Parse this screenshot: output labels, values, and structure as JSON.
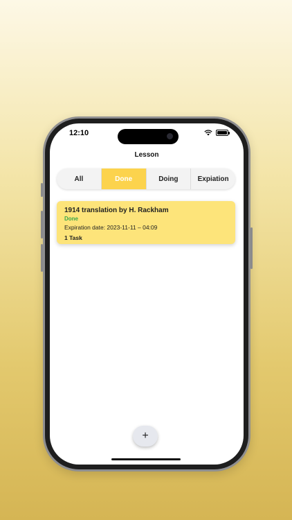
{
  "status_bar": {
    "time": "12:10"
  },
  "nav": {
    "title": "Lesson"
  },
  "tabs": [
    {
      "label": "All",
      "active": false
    },
    {
      "label": "Done",
      "active": true
    },
    {
      "label": "Doing",
      "active": false
    },
    {
      "label": "Expiation",
      "active": false
    }
  ],
  "lessons": [
    {
      "title": "1914 translation by H. Rackham",
      "status": "Done",
      "expiration": "Expiration date: 2023-11-11 – 04:09",
      "tasks": "1 Task"
    }
  ],
  "fab": {
    "icon": "plus-icon",
    "glyph": "+"
  },
  "colors": {
    "accent": "#fcd34d",
    "card": "#fde47a",
    "status_done": "#3aa64a"
  }
}
